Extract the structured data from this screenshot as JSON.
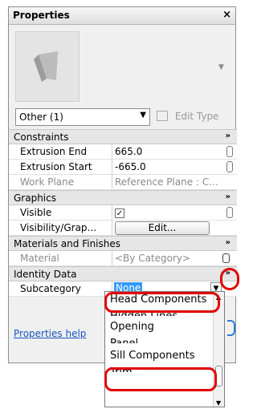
{
  "panel": {
    "title": "Properties",
    "close": "×"
  },
  "type_selector": {
    "value": "Other (1)",
    "edit_type": "Edit Type"
  },
  "sections": {
    "constraints": "Constraints",
    "graphics": "Graphics",
    "materials": "Materials and Finishes",
    "identity": "Identity Data",
    "collapse_glyph": "»"
  },
  "rows": {
    "extrusion_end": {
      "label": "Extrusion End",
      "value": "665.0"
    },
    "extrusion_start": {
      "label": "Extrusion Start",
      "value": "-665.0"
    },
    "work_plane": {
      "label": "Work Plane",
      "value": "Reference Plane : C..."
    },
    "visible": {
      "label": "Visible",
      "checked": "✓"
    },
    "visibility": {
      "label": "Visibility/Grap...",
      "button": "Edit..."
    },
    "material": {
      "label": "Material",
      "value": "<By Category>"
    },
    "subcategory": {
      "label": "Subcategory",
      "value": "None"
    }
  },
  "footer": {
    "help_link": "Properties help"
  },
  "dropdown": {
    "options": [
      "Head Components",
      "Hidden Lines",
      "Opening",
      "Panel",
      "Sill Components",
      "Trim"
    ]
  },
  "colors": {
    "highlight": "#e10000",
    "selection": "#3399ff",
    "link": "#1a55c0"
  }
}
